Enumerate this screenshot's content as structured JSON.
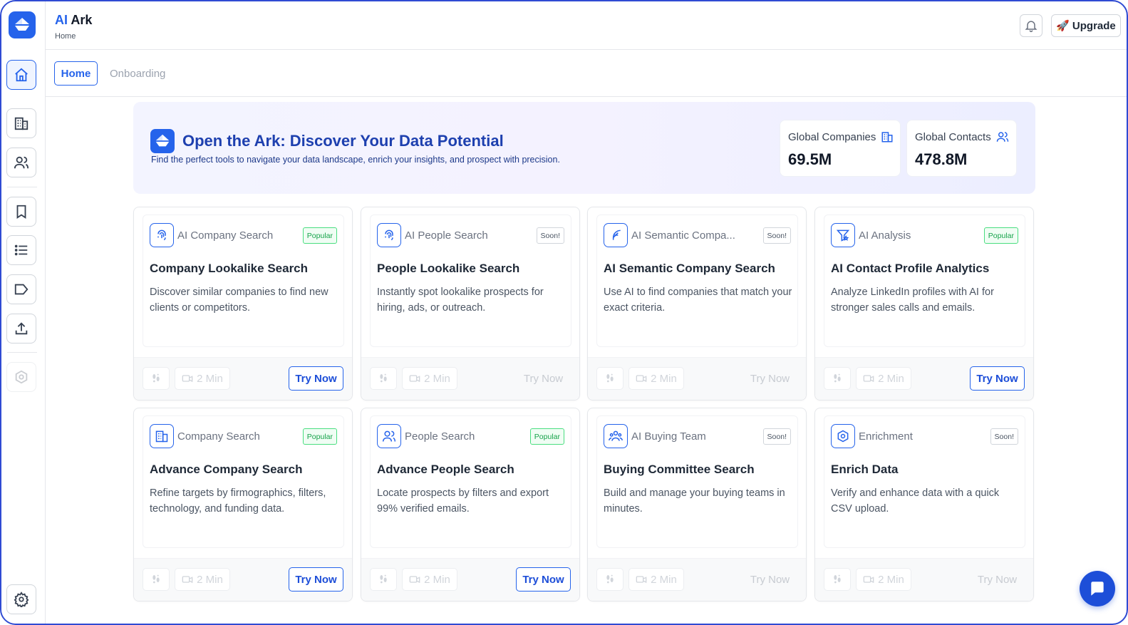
{
  "app": {
    "brand_ai": "AI",
    "brand_rest": " Ark",
    "breadcrumb": "Home"
  },
  "header": {
    "upgrade_label": "Upgrade",
    "upgrade_emoji": "🚀"
  },
  "tabs": [
    {
      "label": "Home",
      "active": true
    },
    {
      "label": "Onboarding",
      "active": false
    }
  ],
  "hero": {
    "title": "Open the Ark: Discover Your Data Potential",
    "subtitle": "Find the perfect tools to navigate your data landscape, enrich your insights, and prospect with precision.",
    "stats": [
      {
        "label": "Global Companies",
        "value": "69.5M",
        "icon": "building-icon"
      },
      {
        "label": "Global Contacts",
        "value": "478.8M",
        "icon": "users-icon"
      }
    ]
  },
  "cards": [
    {
      "category": "AI Company Search",
      "badge": "Popular",
      "badge_type": "popular",
      "title": "Company Lookalike Search",
      "desc": "Discover similar companies to find new clients or competitors.",
      "time": "2 Min",
      "action": "Try Now",
      "enabled": true,
      "icon": "fingerprint-icon"
    },
    {
      "category": "AI People Search",
      "badge": "Soon!",
      "badge_type": "soon",
      "title": "People Lookalike Search",
      "desc": "Instantly spot lookalike prospects for hiring, ads, or outreach.",
      "time": "2 Min",
      "action": "Try Now",
      "enabled": false,
      "icon": "fingerprint-icon"
    },
    {
      "category": "AI Semantic Compa...",
      "badge": "Soon!",
      "badge_type": "soon",
      "title": "AI Semantic Company Search",
      "desc": "Use AI to find companies that match your exact criteria.",
      "time": "2 Min",
      "action": "Try Now",
      "enabled": false,
      "icon": "feather-icon"
    },
    {
      "category": "AI Analysis",
      "badge": "Popular",
      "badge_type": "popular",
      "title": "AI Contact Profile Analytics",
      "desc": "Analyze LinkedIn profiles with AI for stronger sales calls and emails.",
      "time": "2 Min",
      "action": "Try Now",
      "enabled": true,
      "icon": "filter-star-icon"
    },
    {
      "category": "Company Search",
      "badge": "Popular",
      "badge_type": "popular",
      "title": "Advance Company Search",
      "desc": "Refine targets by firmographics, filters, technology, and funding data.",
      "time": "2 Min",
      "action": "Try Now",
      "enabled": true,
      "icon": "building-icon"
    },
    {
      "category": "People Search",
      "badge": "Popular",
      "badge_type": "popular",
      "title": "Advance People Search",
      "desc": "Locate prospects by filters and export 99% verified emails.",
      "time": "2 Min",
      "action": "Try Now",
      "enabled": true,
      "icon": "users-icon"
    },
    {
      "category": "AI Buying Team",
      "badge": "Soon!",
      "badge_type": "soon",
      "title": "Buying Committee Search",
      "desc": "Build and manage your buying teams in minutes.",
      "time": "2 Min",
      "action": "Try Now",
      "enabled": false,
      "icon": "team-icon"
    },
    {
      "category": "Enrichment",
      "badge": "Soon!",
      "badge_type": "soon",
      "title": "Enrich Data",
      "desc": "Verify and enhance data with a quick CSV upload.",
      "time": "2 Min",
      "action": "Try Now",
      "enabled": false,
      "icon": "enrich-icon"
    }
  ],
  "sidebar": {
    "items": [
      {
        "name": "home-icon",
        "active": true
      },
      {
        "name": "building-icon",
        "active": false
      },
      {
        "name": "users-icon",
        "active": false
      },
      {
        "name": "bookmark-icon",
        "active": false
      },
      {
        "name": "list-icon",
        "active": false
      },
      {
        "name": "tag-icon",
        "active": false
      },
      {
        "name": "upload-icon",
        "active": false
      },
      {
        "name": "enrich-icon",
        "active": false,
        "disabled": true
      }
    ],
    "settings_icon": "gear-icon"
  },
  "colors": {
    "accent": "#2563eb",
    "popular": "#16a34a",
    "frame": "#2f4bd3"
  }
}
